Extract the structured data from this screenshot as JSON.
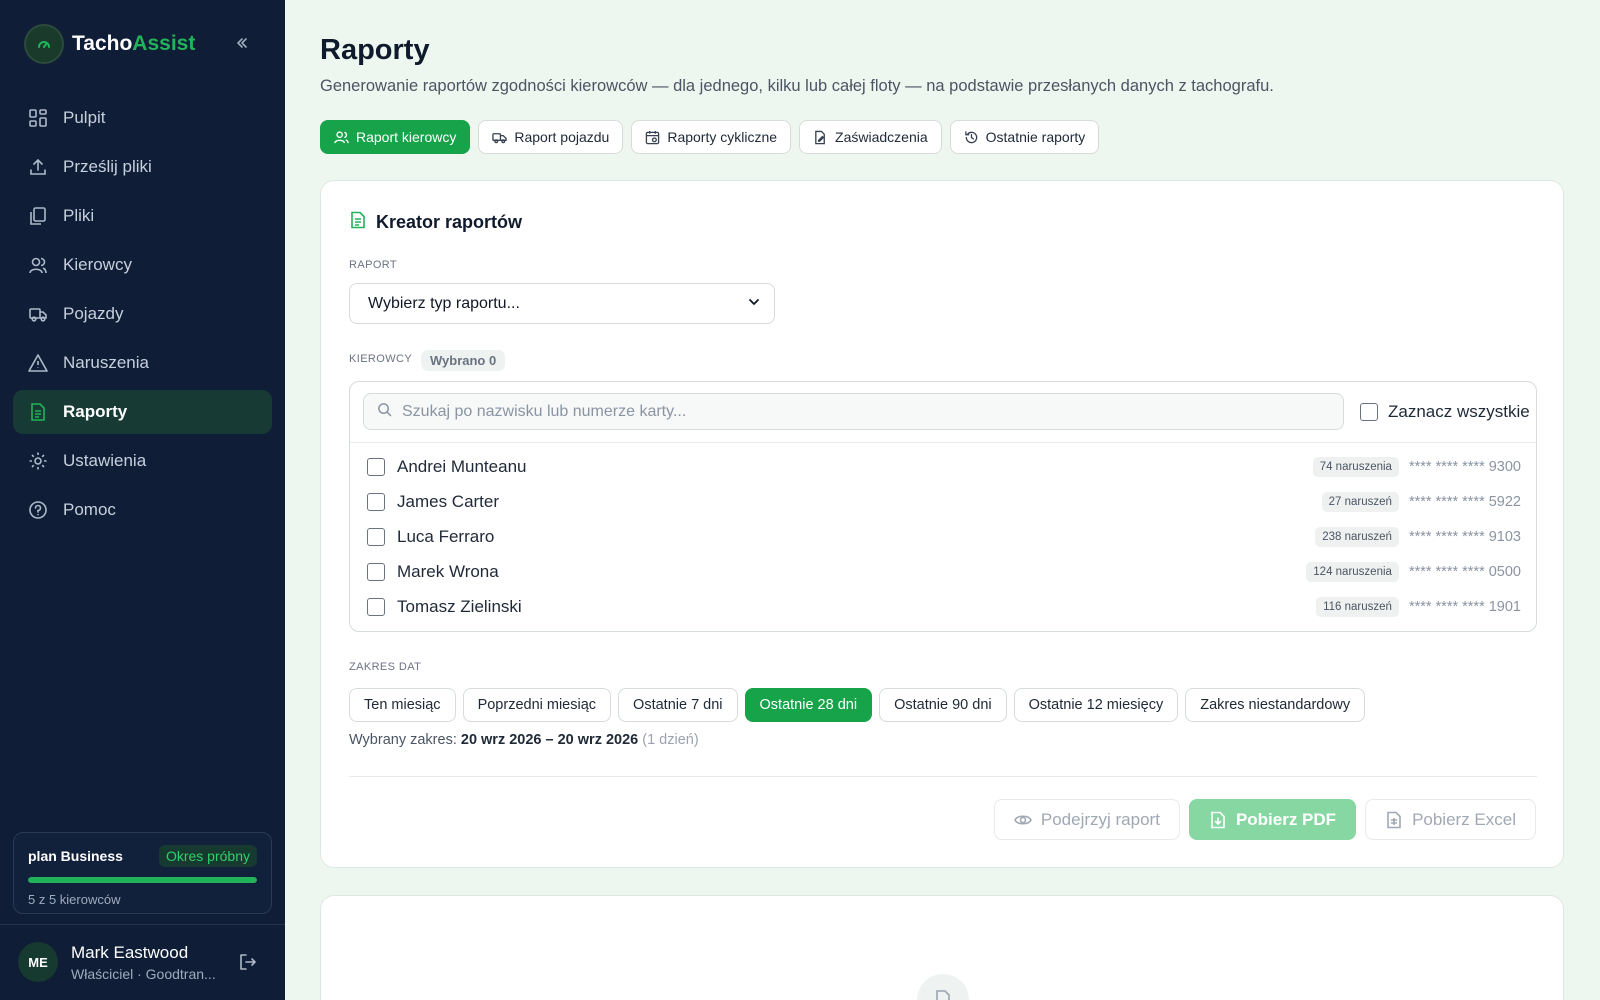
{
  "brand": {
    "name_part1": "Tacho",
    "name_part2": "Assist"
  },
  "sidebar": {
    "items": [
      {
        "label": "Pulpit",
        "icon": "dashboard-icon"
      },
      {
        "label": "Prześlij pliki",
        "icon": "upload-icon"
      },
      {
        "label": "Pliki",
        "icon": "files-icon"
      },
      {
        "label": "Kierowcy",
        "icon": "users-icon"
      },
      {
        "label": "Pojazdy",
        "icon": "truck-icon"
      },
      {
        "label": "Naruszenia",
        "icon": "warning-icon"
      },
      {
        "label": "Raporty",
        "icon": "report-icon",
        "active": true
      },
      {
        "label": "Ustawienia",
        "icon": "gear-icon"
      },
      {
        "label": "Pomoc",
        "icon": "help-icon"
      }
    ],
    "plan": {
      "name": "plan Business",
      "badge": "Okres próbny",
      "usage": "5 z 5 kierowców",
      "usage_fraction": 1.0
    },
    "user": {
      "initials": "ME",
      "name": "Mark Eastwood",
      "role": "Właściciel · Goodtran..."
    }
  },
  "header": {
    "title": "Raporty",
    "subtitle": "Generowanie raportów zgodności kierowców — dla jednego, kilku lub całej floty — na podstawie przesłanych danych z tachografu."
  },
  "tabs": [
    {
      "label": "Raport kierowcy",
      "icon": "user-icon",
      "active": true
    },
    {
      "label": "Raport pojazdu",
      "icon": "truck-icon"
    },
    {
      "label": "Raporty cykliczne",
      "icon": "calendar-icon"
    },
    {
      "label": "Zaświadczenia",
      "icon": "edit-doc-icon"
    },
    {
      "label": "Ostatnie raporty",
      "icon": "history-icon"
    }
  ],
  "creator": {
    "title": "Kreator raportów",
    "report_label": "RAPORT",
    "report_select": "Wybierz typ raportu...",
    "drivers_label": "KIEROWCY",
    "selected_count": "Wybrano 0",
    "search_placeholder": "Szukaj po nazwisku lub numerze karty...",
    "select_all": "Zaznacz wszystkie",
    "drivers": [
      {
        "name": "Andrei Munteanu",
        "violations": "74 naruszenia",
        "card": "**** **** **** 9300"
      },
      {
        "name": "James Carter",
        "violations": "27 naruszeń",
        "card": "**** **** **** 5922"
      },
      {
        "name": "Luca Ferraro",
        "violations": "238 naruszeń",
        "card": "**** **** **** 9103"
      },
      {
        "name": "Marek Wrona",
        "violations": "124 naruszenia",
        "card": "**** **** **** 0500"
      },
      {
        "name": "Tomasz Zielinski",
        "violations": "116 naruszeń",
        "card": "**** **** **** 1901"
      }
    ],
    "date_label": "ZAKRES DAT",
    "ranges": [
      {
        "label": "Ten miesiąc"
      },
      {
        "label": "Poprzedni miesiąc"
      },
      {
        "label": "Ostatnie 7 dni"
      },
      {
        "label": "Ostatnie 28 dni",
        "active": true
      },
      {
        "label": "Ostatnie 90 dni"
      },
      {
        "label": "Ostatnie 12 miesięcy"
      },
      {
        "label": "Zakres niestandardowy"
      }
    ],
    "range_prefix": "Wybrany zakres:",
    "range_value": "20 wrz 2026 – 20 wrz 2026",
    "range_days": "(1 dzień)",
    "actions": {
      "preview": "Podejrzyj raport",
      "pdf": "Pobierz PDF",
      "excel": "Pobierz Excel"
    }
  },
  "colors": {
    "accent": "#17a34a",
    "sidebar_bg": "#0f1d36",
    "page_bg": "#eef7ef"
  }
}
